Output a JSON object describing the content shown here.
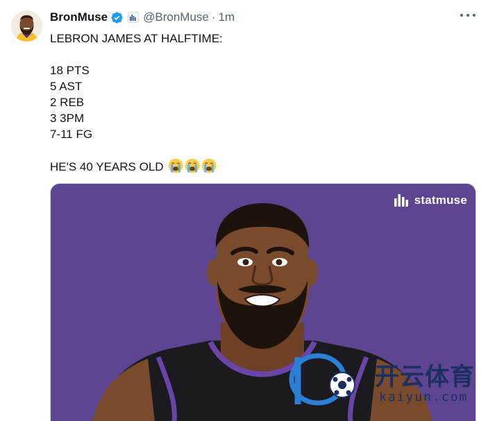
{
  "tweet": {
    "display_name": "BronMuse",
    "handle": "@BronMuse",
    "separator": "·",
    "time": "1m",
    "verified_icon": "verified-badge-icon",
    "affiliate_icon": "statmuse-affiliate-icon",
    "more_icon": "more-options-icon",
    "lines": [
      "LEBRON JAMES AT HALFTIME:",
      "",
      "18 PTS",
      "5 AST",
      "2 REB",
      "3 3PM",
      "7-11 FG",
      "",
      "HE'S 40 YEARS OLD"
    ],
    "emoji_icons": [
      "loudly-crying-face-emoji",
      "loudly-crying-face-emoji",
      "loudly-crying-face-emoji"
    ]
  },
  "media": {
    "brand": "statmuse",
    "background_color": "#5e4591",
    "illustration": "lebron-james-cartoon-illustration"
  },
  "watermark": {
    "chinese_text": "开云体育",
    "url_text": "kaiyun.com"
  },
  "colors": {
    "text": "#0f1419",
    "secondary": "#536471",
    "verified": "#1d9bf0"
  }
}
